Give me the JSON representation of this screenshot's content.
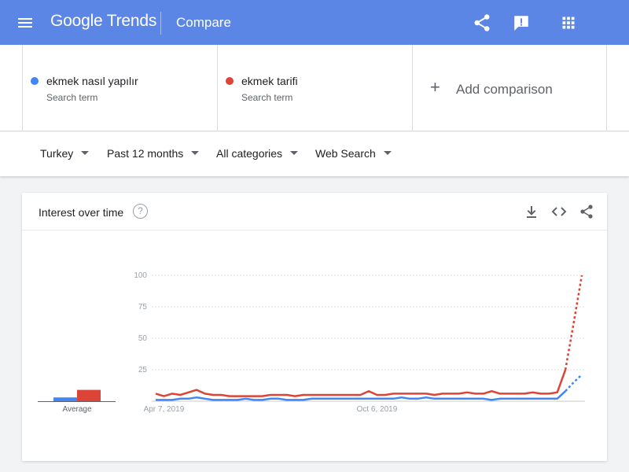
{
  "header": {
    "logo": "Google Trends",
    "page_title": "Compare",
    "icons": [
      "menu-icon",
      "share-icon",
      "feedback-icon",
      "apps-icon"
    ]
  },
  "terms": [
    {
      "name": "ekmek nasıl yapılır",
      "sub": "Search term",
      "color": "#4285f4"
    },
    {
      "name": "ekmek tarifi",
      "sub": "Search term",
      "color": "#db4437"
    }
  ],
  "add_comparison": {
    "label": "Add comparison"
  },
  "filters": {
    "region": "Turkey",
    "period": "Past 12 months",
    "category": "All categories",
    "search_type": "Web Search"
  },
  "card": {
    "title": "Interest over time",
    "help_glyph": "?",
    "icons": [
      "download-icon",
      "embed-icon",
      "share-icon"
    ]
  },
  "chart_data": {
    "type": "line",
    "y_ticks": [
      "100",
      "75",
      "50",
      "25"
    ],
    "ylim": [
      0,
      100
    ],
    "x_ticks": [
      {
        "label": "Apr 7, 2019",
        "index": 1
      },
      {
        "label": "Oct 6, 2019",
        "index": 27
      }
    ],
    "average_label": "Average",
    "averages": [
      {
        "term": "ekmek nasıl yapılır",
        "value": 3,
        "color": "#4285f4"
      },
      {
        "term": "ekmek tarifi",
        "value": 9,
        "color": "#db4437"
      }
    ],
    "partial_points": 2,
    "series": [
      {
        "name": "ekmek tarifi",
        "color": "#db4437",
        "values": [
          6,
          4,
          6,
          5,
          7,
          9,
          6,
          5,
          5,
          4,
          4,
          4,
          4,
          4,
          5,
          5,
          5,
          4,
          5,
          5,
          5,
          5,
          5,
          5,
          5,
          5,
          8,
          5,
          5,
          6,
          6,
          6,
          6,
          6,
          5,
          6,
          6,
          6,
          7,
          6,
          6,
          8,
          6,
          6,
          6,
          6,
          7,
          6,
          6,
          7,
          25,
          62,
          100
        ]
      },
      {
        "name": "ekmek nasıl yapılır",
        "color": "#4285f4",
        "values": [
          1,
          1,
          1,
          2,
          2,
          3,
          2,
          1,
          1,
          1,
          1,
          2,
          1,
          1,
          2,
          2,
          1,
          1,
          1,
          2,
          2,
          2,
          2,
          2,
          2,
          2,
          2,
          2,
          2,
          2,
          3,
          2,
          2,
          3,
          2,
          2,
          2,
          2,
          2,
          2,
          2,
          1,
          2,
          2,
          2,
          2,
          2,
          2,
          2,
          2,
          8,
          15,
          21
        ]
      }
    ]
  }
}
